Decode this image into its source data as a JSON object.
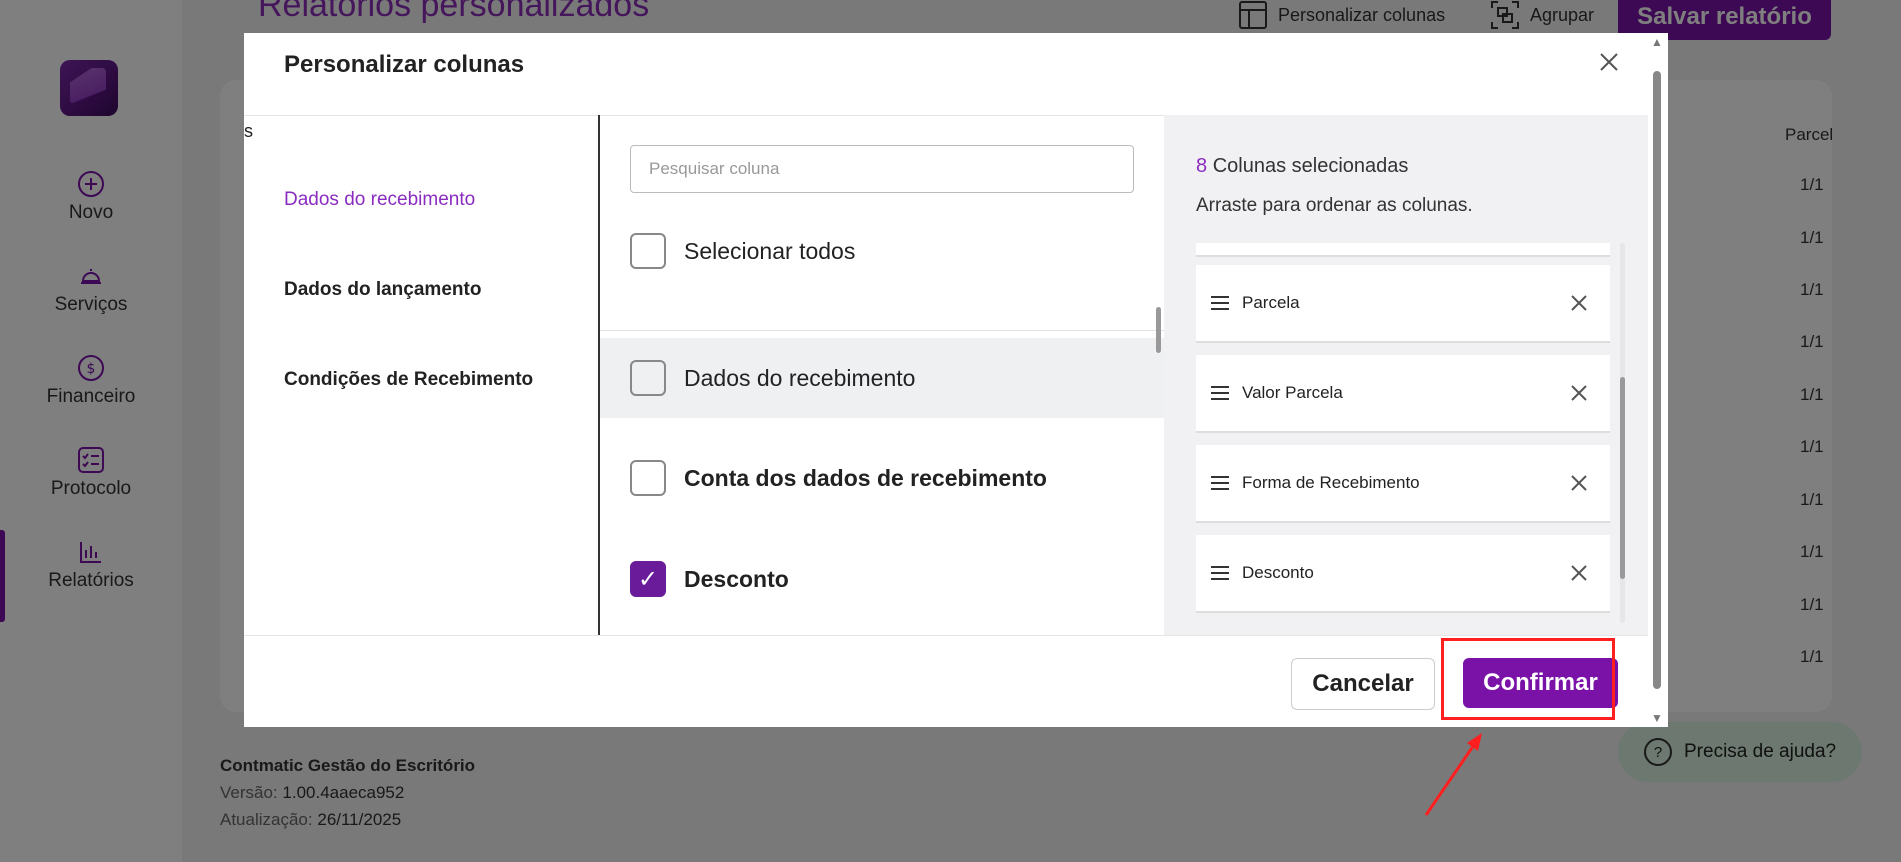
{
  "background": {
    "page_title": "Relatórios personalizados",
    "toolbar": {
      "customize_columns": "Personalizar colunas",
      "group": "Agrupar",
      "save_report": "Salvar relatório"
    },
    "table": {
      "header_fragment": "Parcel",
      "cells": [
        "1/1",
        "1/1",
        "1/1",
        "1/1",
        "1/1",
        "1/1",
        "1/1",
        "1/1",
        "1/1",
        "1/1"
      ]
    },
    "sidebar": [
      {
        "label": "Novo",
        "icon": "plus-circle-icon"
      },
      {
        "label": "Serviços",
        "icon": "service-bell-icon"
      },
      {
        "label": "Financeiro",
        "icon": "dollar-circle-icon"
      },
      {
        "label": "Protocolo",
        "icon": "checklist-icon"
      },
      {
        "label": "Relatórios",
        "icon": "bar-chart-icon"
      }
    ],
    "footer": {
      "company": "Contmatic Gestão do Escritório",
      "version_label": "Versão:",
      "version": "1.00.4aaeca952",
      "updated_label": "Atualização:",
      "updated": "26/11/2025"
    },
    "help": "Precisa de ajuda?"
  },
  "modal": {
    "title": "Personalizar colunas",
    "stray_char": "s",
    "categories": [
      "Dados do recebimento",
      "Dados do lançamento",
      "Condições de Recebimento"
    ],
    "search_placeholder": "Pesquisar coluna",
    "select_all": "Selecionar todos",
    "options": [
      {
        "label": "Dados do recebimento",
        "checked": false
      },
      {
        "label": "Conta dos dados de recebimento",
        "checked": false
      },
      {
        "label": "Desconto",
        "checked": true
      }
    ],
    "selected_count": "8",
    "selected_label": "Colunas selecionadas",
    "drag_hint": "Arraste para ordenar as colunas.",
    "selected_columns": [
      "Parcela",
      "Valor Parcela",
      "Forma de Recebimento",
      "Desconto"
    ],
    "cancel": "Cancelar",
    "confirm": "Confirmar"
  },
  "colors": {
    "brand": "#7a12a8",
    "accent_text": "#8b2cc0",
    "annotation": "#ff1f1f"
  }
}
